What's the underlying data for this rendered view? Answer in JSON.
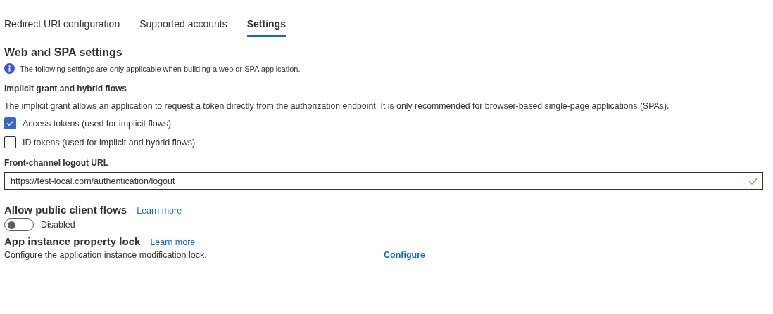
{
  "tabs": [
    {
      "label": "Redirect URI configuration",
      "selected": false
    },
    {
      "label": "Supported accounts",
      "selected": false
    },
    {
      "label": "Settings",
      "selected": true
    }
  ],
  "web_spa": {
    "title": "Web and SPA settings",
    "info": "The following settings are only applicable when building a web or SPA application.",
    "implicit": {
      "title": "Implicit grant and hybrid flows",
      "description": "The implicit grant allows an application to request a token directly from the authorization endpoint. It is only recommended for browser-based single-page applications (SPAs).",
      "options": [
        {
          "label": "Access tokens (used for implicit flows)",
          "checked": true
        },
        {
          "label": "ID tokens (used for implicit and hybrid flows)",
          "checked": false
        }
      ]
    },
    "logout": {
      "label": "Front-channel logout URL",
      "value": "https://test-local.com/authentication/logout",
      "valid": true
    }
  },
  "public_client": {
    "title": "Allow public client flows",
    "link": "Learn more",
    "toggle": {
      "on": false,
      "label": "Disabled"
    }
  },
  "property_lock": {
    "title": "App instance property lock",
    "link": "Learn more",
    "description": "Configure the application instance modification lock.",
    "action": "Configure"
  }
}
